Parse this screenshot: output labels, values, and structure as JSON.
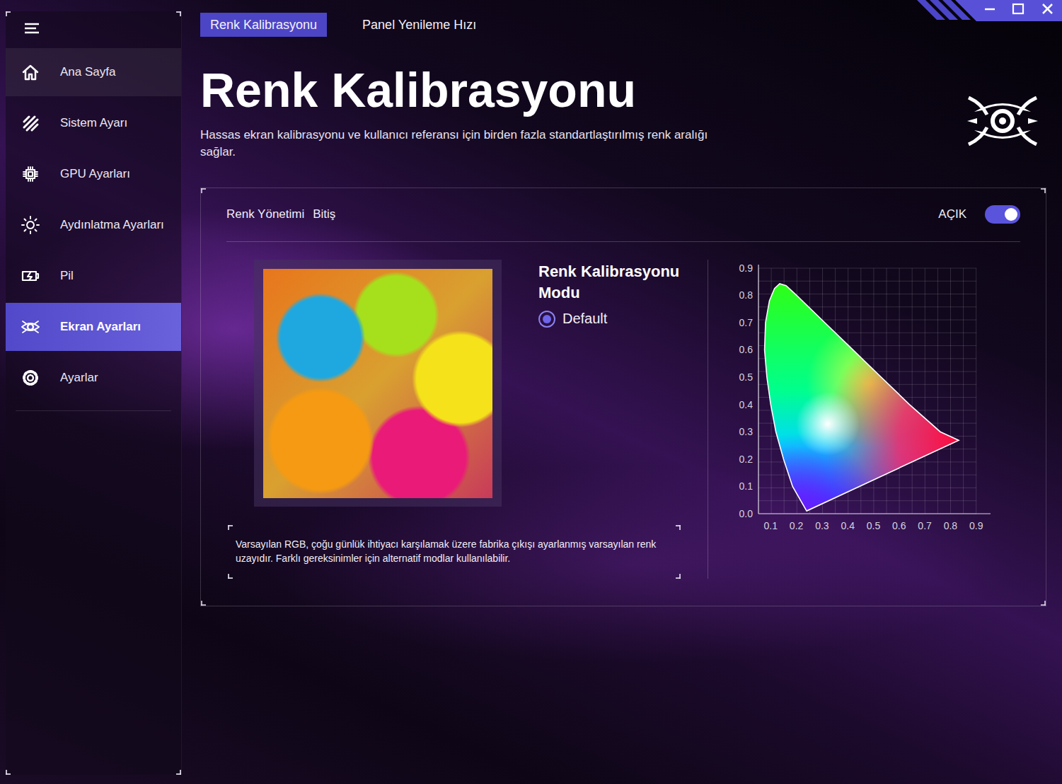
{
  "sidebar": {
    "items": [
      {
        "label": "Ana Sayfa",
        "selected": false,
        "hovered": true
      },
      {
        "label": "Sistem Ayarı",
        "selected": false,
        "hovered": false
      },
      {
        "label": "GPU Ayarları",
        "selected": false,
        "hovered": false
      },
      {
        "label": "Aydınlatma Ayarları",
        "selected": false,
        "hovered": false
      },
      {
        "label": "Pil",
        "selected": false,
        "hovered": false
      },
      {
        "label": "Ekran Ayarları",
        "selected": true,
        "hovered": false
      },
      {
        "label": "Ayarlar",
        "selected": false,
        "hovered": false
      }
    ]
  },
  "tabs": [
    {
      "label": "Renk Kalibrasyonu",
      "selected": true
    },
    {
      "label": "Panel Yenileme Hızı",
      "selected": false
    }
  ],
  "page": {
    "title": "Renk Kalibrasyonu",
    "description": "Hassas ekran kalibrasyonu ve kullanıcı referansı için birden fazla standartlaştırılmış renk aralığı sağlar."
  },
  "panel": {
    "title": "Renk Yönetimi",
    "subtitle": "Bitiş",
    "toggle": {
      "label": "AÇIK",
      "on": true
    },
    "mode": {
      "title": "Renk Kalibrasyonu Modu",
      "options": [
        {
          "label": "Default",
          "selected": true
        }
      ]
    },
    "note": "Varsayılan RGB, çoğu günlük ihtiyacı karşılamak üzere fabrika çıkışı ayarlanmış varsayılan renk uzayıdır. Farklı gereksinimler için alternatif modlar kullanılabilir.",
    "chart": {
      "y_ticks": [
        "0.9",
        "0.8",
        "0.7",
        "0.6",
        "0.5",
        "0.4",
        "0.3",
        "0.2",
        "0.1",
        "0.0"
      ],
      "x_ticks": [
        "0.1",
        "0.2",
        "0.3",
        "0.4",
        "0.5",
        "0.6",
        "0.7",
        "0.8",
        "0.9"
      ],
      "locus": {
        "x": [
          0.24,
          0.185,
          0.15,
          0.12,
          0.1,
          0.085,
          0.076,
          0.08,
          0.095,
          0.115,
          0.135,
          0.16,
          0.2,
          0.31,
          0.42,
          0.53,
          0.64,
          0.76,
          0.832
        ],
        "y": [
          0.01,
          0.1,
          0.2,
          0.3,
          0.4,
          0.5,
          0.6,
          0.7,
          0.78,
          0.825,
          0.842,
          0.835,
          0.8,
          0.7,
          0.6,
          0.5,
          0.4,
          0.3,
          0.269
        ]
      }
    }
  }
}
